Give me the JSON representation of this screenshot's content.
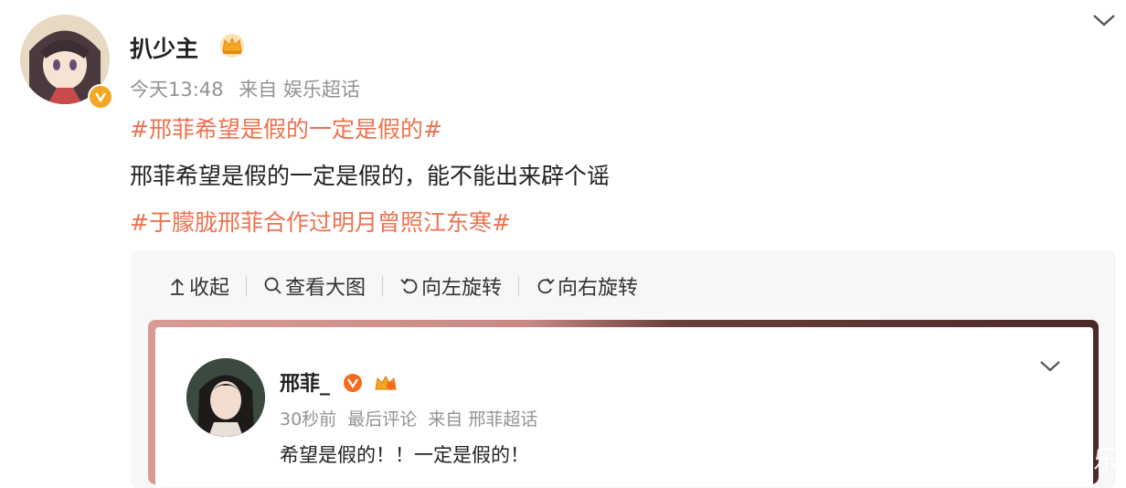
{
  "post": {
    "author": "扒少主",
    "time": "今天13:48",
    "source": "来自 娱乐超话",
    "topic1": "#邢菲希望是假的一定是假的#",
    "text": "邢菲希望是假的一定是假的，能不能出来辟个谣",
    "topic2": "#于朦胧邢菲合作过明月曾照江东寒#"
  },
  "toolbar": {
    "collapse": "收起",
    "view_large": "查看大图",
    "rotate_left": "向左旋转",
    "rotate_right": "向右旋转"
  },
  "comment": {
    "author": "邢菲_",
    "time": "30秒前",
    "label": "最后评论",
    "source": "来自 邢菲超话",
    "text": "希望是假的！！一定是假的！"
  },
  "watermark": "乐",
  "icons": {
    "verified": "verified-badge-icon",
    "crown": "crown-icon",
    "expand": "chevron-down-icon"
  },
  "colors": {
    "topic": "#eb7350",
    "meta": "#939393",
    "verified": "#f5a623"
  }
}
